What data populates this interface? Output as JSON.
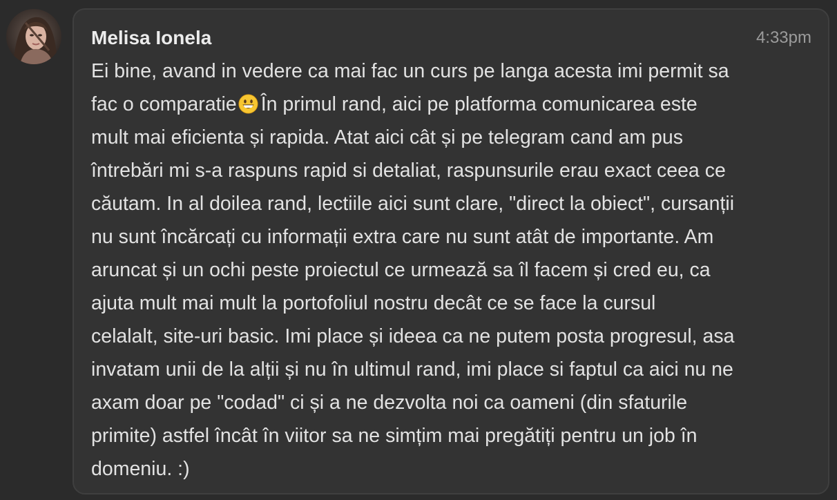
{
  "message": {
    "author": "Melisa Ionela",
    "time": "4:33pm",
    "lines": [
      "Ei bine, avand in vedere ca mai fac un curs pe langa acesta imi permit sa",
      "fac o comparatie",
      "În primul rand, aici pe platforma comunicarea este",
      "mult mai eficienta și rapida. Atat aici cât și pe telegram cand am pus",
      "întrebări mi s-a raspuns rapid si detaliat, raspunsurile erau exact ceea ce",
      "căutam. In al doilea rand, lectiile aici sunt clare, \"direct la obiect\", cursanții",
      "nu sunt încărcați cu informații extra care nu sunt atât de importante. Am",
      "aruncat și un ochi peste proiectul ce urmează sa îl facem și cred eu, ca",
      "ajuta mult mai mult la portofoliul nostru decât ce se face la cursul",
      "celalalt, site-uri basic. Imi place și ideea ca ne putem posta progresul, asa",
      "invatam unii de la alții și nu în ultimul rand, imi place si faptul ca aici nu ne",
      "axam doar pe \"codad\" ci și a ne dezvolta noi ca oameni (din sfaturile",
      "primite) astfel încât în viitor sa ne simțim mai pregătiți pentru un job în",
      "domeniu. :)"
    ],
    "emoji": "grinning-face-emoji"
  },
  "colors": {
    "background": "#2b2b2b",
    "bubble": "#333333",
    "bubble_border": "#3f3f3f",
    "author": "#ececec",
    "text": "#e2e2e2",
    "time": "#9b9b9b"
  }
}
